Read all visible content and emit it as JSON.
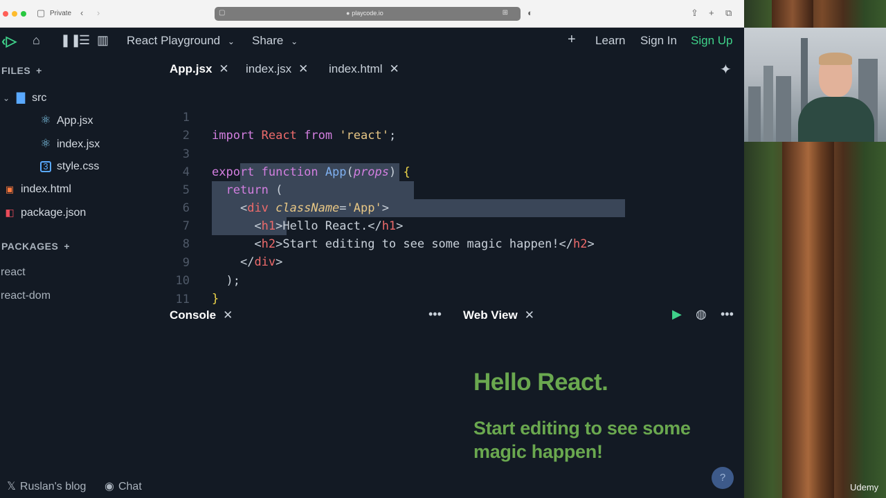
{
  "browser": {
    "mode_label": "Private",
    "url": "playcode.io"
  },
  "header": {
    "project_name": "React Playground",
    "share_label": "Share",
    "plus_label": "+",
    "learn_label": "Learn",
    "signin_label": "Sign In",
    "signup_label": "Sign Up"
  },
  "sidebar": {
    "files_heading": "FILES",
    "tree": [
      {
        "label": "src"
      },
      {
        "label": "App.jsx"
      },
      {
        "label": "index.jsx"
      },
      {
        "label": "style.css"
      },
      {
        "label": "index.html"
      },
      {
        "label": "package.json"
      }
    ],
    "packages_heading": "PACKAGES",
    "packages": [
      "react",
      "react-dom"
    ]
  },
  "tabs": [
    {
      "label": "App.jsx",
      "active": true
    },
    {
      "label": "index.jsx",
      "active": false
    },
    {
      "label": "index.html",
      "active": false
    }
  ],
  "code_lines": [
    "import React from 'react';",
    "",
    "export function App(props) {",
    "  return (",
    "    <div className='App'>",
    "      <h1>Hello React.</h1>",
    "      <h2>Start editing to see some magic happen!</h2>",
    "    </div>",
    "  );",
    "}",
    ""
  ],
  "line_numbers": [
    "1",
    "2",
    "3",
    "4",
    "5",
    "6",
    "7",
    "8",
    "9",
    "10",
    "11"
  ],
  "console": {
    "title": "Console"
  },
  "webview": {
    "title": "Web View",
    "h1": "Hello React.",
    "h2": "Start editing to see some magic happen!"
  },
  "footer": {
    "blog_label": "Ruslan's blog",
    "chat_label": "Chat"
  },
  "help_label": "?",
  "watermark": "Udemy",
  "colors": {
    "accent": "#3fd28a",
    "preview_text": "#6aa84f",
    "editor_bg": "#131a24"
  }
}
